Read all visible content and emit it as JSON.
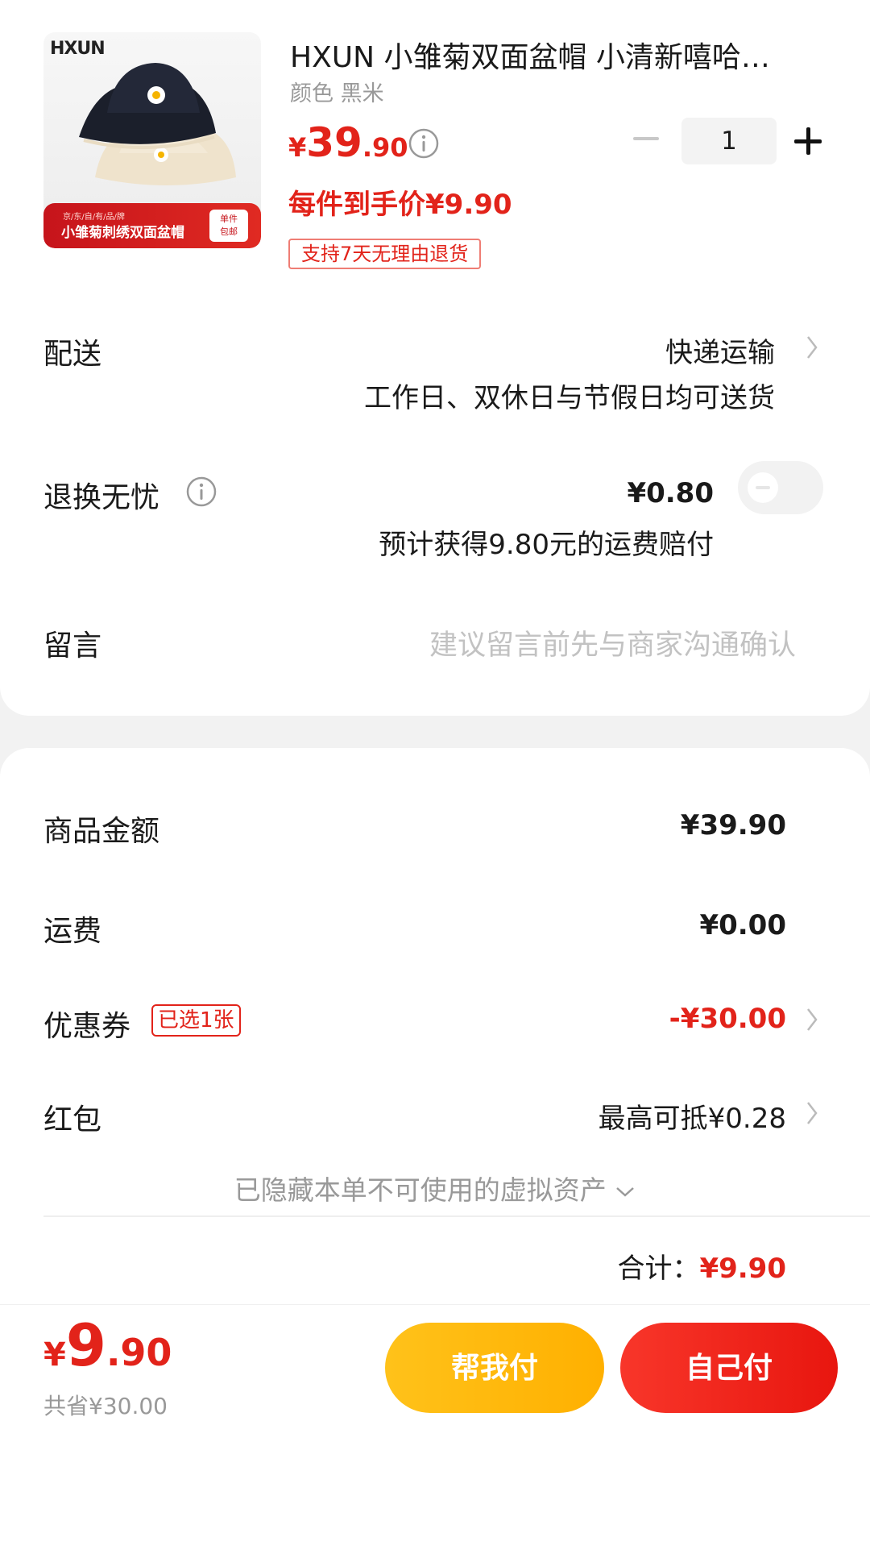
{
  "product": {
    "image_brand": "HXUN",
    "image_banner_sub": "京/东/自/有/品/牌",
    "image_banner_title": "小雏菊刺绣双面盆帽",
    "image_badge_line1": "单件",
    "image_badge_line2": "包邮",
    "title": "HXUN 小雏菊双面盆帽 小清新嘻哈…",
    "color_spec": "颜色 黑米",
    "price_currency": "¥",
    "price_int": "39",
    "price_dec": ".90",
    "hand_price": "每件到手价¥9.90",
    "return_tag": "支持7天无理由退货",
    "quantity": "1"
  },
  "delivery": {
    "label": "配送",
    "method": "快递运输",
    "note": "工作日、双休日与节假日均可送货"
  },
  "return_insurance": {
    "label": "退换无忧",
    "price": "¥0.80",
    "note": "预计获得9.80元的运费赔付",
    "enabled": false
  },
  "message": {
    "label": "留言",
    "placeholder": "建议留言前先与商家沟通确认"
  },
  "summary": {
    "goods_label": "商品金额",
    "goods_value": "¥39.90",
    "shipping_label": "运费",
    "shipping_value": "¥0.00",
    "coupon_label": "优惠券",
    "coupon_tag": "已选1张",
    "coupon_value": "-¥30.00",
    "redpacket_label": "红包",
    "redpacket_value": "最高可抵¥0.28",
    "hidden_assets": "已隐藏本单不可使用的虚拟资产",
    "total_label": "合计：",
    "total_value": "¥9.90"
  },
  "bottom": {
    "price_currency": "¥",
    "price_int": "9",
    "price_dec": ".90",
    "saved": "共省¥30.00",
    "help_pay": "帮我付",
    "self_pay": "自己付"
  },
  "colors": {
    "accent_red": "#e2231a",
    "accent_yellow": "#ffb000"
  }
}
